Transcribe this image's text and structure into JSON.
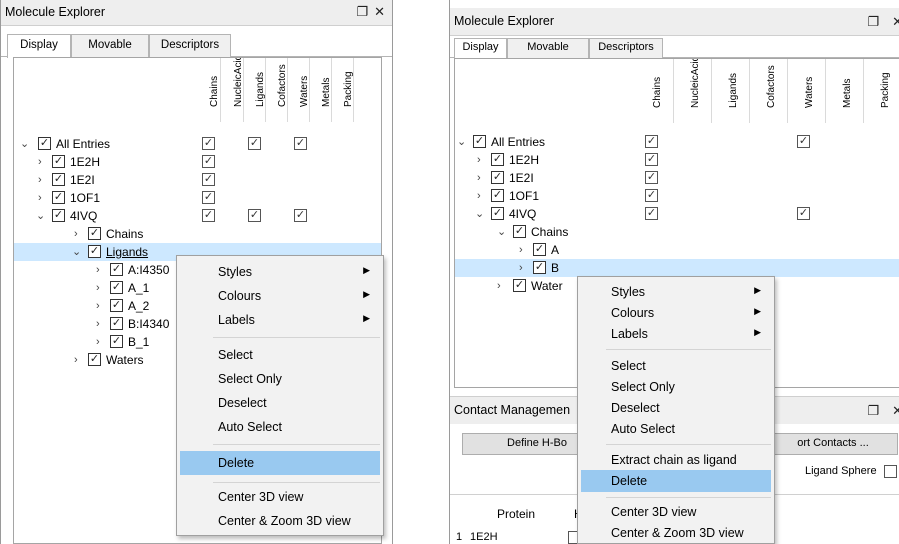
{
  "left_panel": {
    "title": "Molecule Explorer",
    "tabs": [
      "Display",
      "Movable",
      "Descriptors"
    ],
    "columns": [
      "Chains",
      "NucleicAcids",
      "Ligands",
      "Cofactors",
      "Waters",
      "Metals",
      "Packing"
    ],
    "tree": [
      {
        "label": "All Entries",
        "expanded": true
      },
      {
        "label": "1E2H",
        "expanded": false
      },
      {
        "label": "1E2I",
        "expanded": false
      },
      {
        "label": "1OF1",
        "expanded": false
      },
      {
        "label": "4IVQ",
        "expanded": true
      },
      {
        "label": "Chains",
        "expanded": false
      },
      {
        "label": "Ligands",
        "expanded": true,
        "selected": true
      },
      {
        "label": "A:I4350",
        "expanded": false
      },
      {
        "label": "A_1",
        "expanded": false
      },
      {
        "label": "A_2",
        "expanded": false
      },
      {
        "label": "B:I4340",
        "expanded": false
      },
      {
        "label": "B_1",
        "expanded": false
      },
      {
        "label": "Waters",
        "expanded": false
      }
    ],
    "context_menu": {
      "items": [
        "Styles",
        "Colours",
        "Labels",
        "Select",
        "Select Only",
        "Deselect",
        "Auto Select",
        "Delete",
        "Center 3D view",
        "Center & Zoom 3D view"
      ],
      "highlighted": "Delete"
    }
  },
  "right_panel": {
    "title": "Molecule Explorer",
    "tabs": [
      "Display",
      "Movable",
      "Descriptors"
    ],
    "columns": [
      "Chains",
      "NucleicAcids",
      "Ligands",
      "Cofactors",
      "Waters",
      "Metals",
      "Packing"
    ],
    "tree": [
      {
        "label": "All Entries",
        "expanded": true
      },
      {
        "label": "1E2H",
        "expanded": false
      },
      {
        "label": "1E2I",
        "expanded": false
      },
      {
        "label": "1OF1",
        "expanded": false
      },
      {
        "label": "4IVQ",
        "expanded": true
      },
      {
        "label": "Chains",
        "expanded": true
      },
      {
        "label": "A",
        "expanded": false
      },
      {
        "label": "B",
        "expanded": false,
        "selected": true
      },
      {
        "label": "Water",
        "expanded": false
      }
    ],
    "contact_section": {
      "title": "Contact Managemen",
      "button_left": "Define H-Bo",
      "button_right": "ort Contacts ...",
      "ligand_sphere_label": "Ligand Sphere",
      "table_header_protein": "Protein",
      "table_header_h": "H",
      "table_row_index": "1",
      "table_row_value": "1E2H"
    },
    "context_menu": {
      "items": [
        "Styles",
        "Colours",
        "Labels",
        "Select",
        "Select Only",
        "Deselect",
        "Auto Select",
        "Extract chain as ligand",
        "Delete",
        "Center 3D view",
        "Center & Zoom 3D view"
      ],
      "highlighted": "Delete"
    }
  },
  "icons": {
    "float": "❐",
    "close": "✕",
    "check": "✓",
    "chevron_right": "›",
    "chevron_down": "⌄",
    "submenu_arrow": "▶"
  }
}
